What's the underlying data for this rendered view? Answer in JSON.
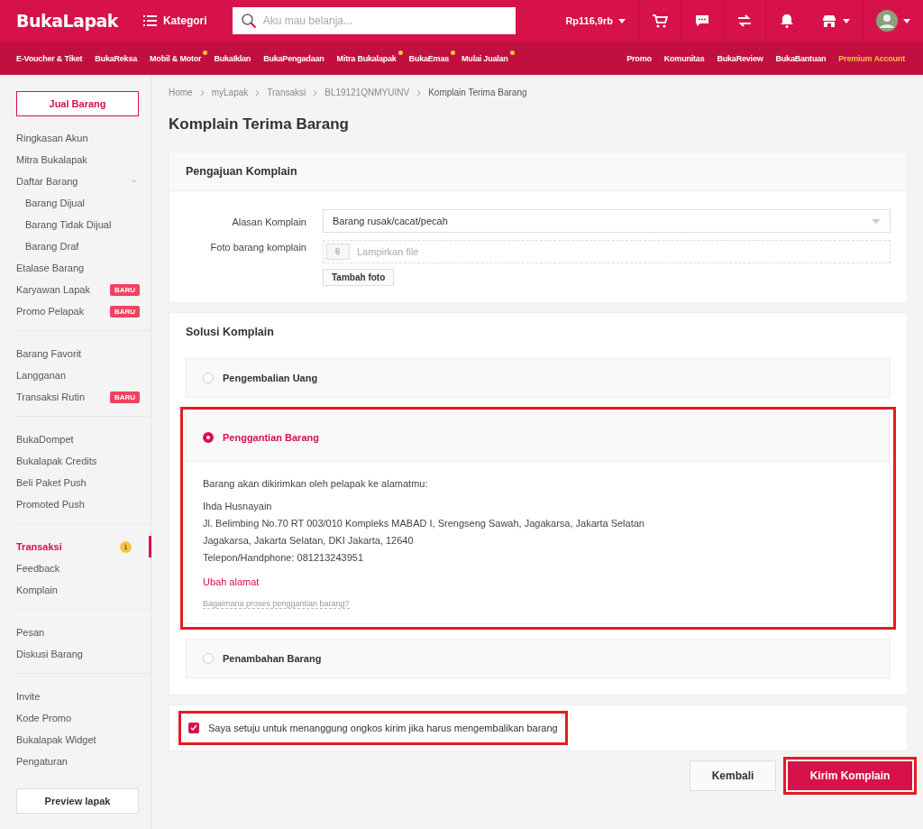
{
  "header": {
    "logo": "BukaLapak",
    "category_button": "Kategori",
    "search": {
      "placeholder": "Aku mau belanja..."
    },
    "balance": "Rp116,9rb"
  },
  "nav_left": [
    {
      "label": "E-Voucher & Tiket",
      "dot": false
    },
    {
      "label": "BukaReksa",
      "dot": false
    },
    {
      "label": "Mobil & Motor",
      "dot": true
    },
    {
      "label": "BukaIklan",
      "dot": false
    },
    {
      "label": "BukaPengadaan",
      "dot": false
    },
    {
      "label": "Mitra Bukalapak",
      "dot": true
    },
    {
      "label": "BukaEmas",
      "dot": true
    },
    {
      "label": "Mulai Jualan",
      "dot": true
    }
  ],
  "nav_right": [
    {
      "label": "Promo",
      "kind": "link"
    },
    {
      "label": "Komunitas",
      "kind": "link"
    },
    {
      "label": "BukaReview",
      "kind": "link"
    },
    {
      "label": "BukaBantuan",
      "kind": "link"
    },
    {
      "label": "Premium Account",
      "kind": "premium"
    }
  ],
  "sidebar": {
    "sell_button": "Jual Barang",
    "groups": [
      [
        {
          "label": "Ringkasan Akun",
          "selected": false
        },
        {
          "label": "Mitra Bukalapak",
          "selected": false
        },
        {
          "label": "Daftar Barang",
          "selected": false,
          "expanded": true,
          "children": [
            {
              "label": "Barang Dijual",
              "selected": false
            },
            {
              "label": "Barang Tidak Dijual",
              "selected": false
            },
            {
              "label": "Barang Draf",
              "selected": false
            }
          ]
        },
        {
          "label": "Etalase Barang",
          "selected": false
        },
        {
          "label": "Karyawan Lapak",
          "selected": false,
          "badge": "BARU"
        },
        {
          "label": "Promo Pelapak",
          "selected": false,
          "badge": "BARU"
        }
      ],
      [
        {
          "label": "Barang Favorit",
          "selected": false
        },
        {
          "label": "Langganan",
          "selected": false
        },
        {
          "label": "Transaksi Rutin",
          "selected": false,
          "badge": "BARU"
        }
      ],
      [
        {
          "label": "BukaDompet",
          "selected": false
        },
        {
          "label": "Bukalapak Credits",
          "selected": false
        },
        {
          "label": "Beli Paket Push",
          "selected": false
        },
        {
          "label": "Promoted Push",
          "selected": false
        }
      ],
      [
        {
          "label": "Transaksi",
          "selected": true,
          "count": "1"
        },
        {
          "label": "Feedback",
          "selected": false
        },
        {
          "label": "Komplain",
          "selected": false
        }
      ],
      [
        {
          "label": "Pesan",
          "selected": false
        },
        {
          "label": "Diskusi Barang",
          "selected": false
        }
      ],
      [
        {
          "label": "Invite",
          "selected": false
        },
        {
          "label": "Kode Promo",
          "selected": false
        },
        {
          "label": "Bukalapak Widget",
          "selected": false
        },
        {
          "label": "Pengaturan",
          "selected": false
        }
      ]
    ],
    "preview_button": "Preview lapak"
  },
  "breadcrumb": [
    "Home",
    "myLapak",
    "Transaksi",
    "BL19121QNMYUINV",
    "Komplain Terima Barang"
  ],
  "page_title": "Komplain Terima Barang",
  "submission": {
    "title": "Pengajuan Komplain",
    "reason_label": "Alasan Komplain",
    "reason_value": "Barang rusak/cacat/pecah",
    "photo_label": "Foto barang komplain",
    "photo_placeholder": "Lampirkan file",
    "add_photo_button": "Tambah foto"
  },
  "solution": {
    "title": "Solusi Komplain",
    "options": [
      {
        "label": "Pengembalian Uang",
        "selected": false,
        "highlighted": false
      },
      {
        "label": "Penggantian Barang",
        "selected": true,
        "highlighted": true,
        "details": {
          "intro": "Barang akan dikirimkan oleh pelapak ke alamatmu:",
          "address_lines": [
            "Ihda Husnayain",
            "Jl. Belimbing No.70 RT 003/010 Kompleks MABAD I, Srengseng Sawah, Jagakarsa, Jakarta Selatan",
            "Jagakarsa, Jakarta Selatan, DKI Jakarta, 12640",
            "Telepon/Handphone: 081213243951"
          ],
          "change_link": "Ubah alamat",
          "help_link": "Bagaimana proses penggantian barang?"
        }
      },
      {
        "label": "Penambahan Barang",
        "selected": false,
        "highlighted": false
      }
    ]
  },
  "consent": {
    "label": "Saya setuju untuk menanggung ongkos kirim jika harus mengembalikan barang",
    "checked": true,
    "highlighted": true
  },
  "actions": {
    "back_button": "Kembali",
    "submit_button": {
      "label": "Kirim Komplain",
      "highlighted": true
    }
  }
}
